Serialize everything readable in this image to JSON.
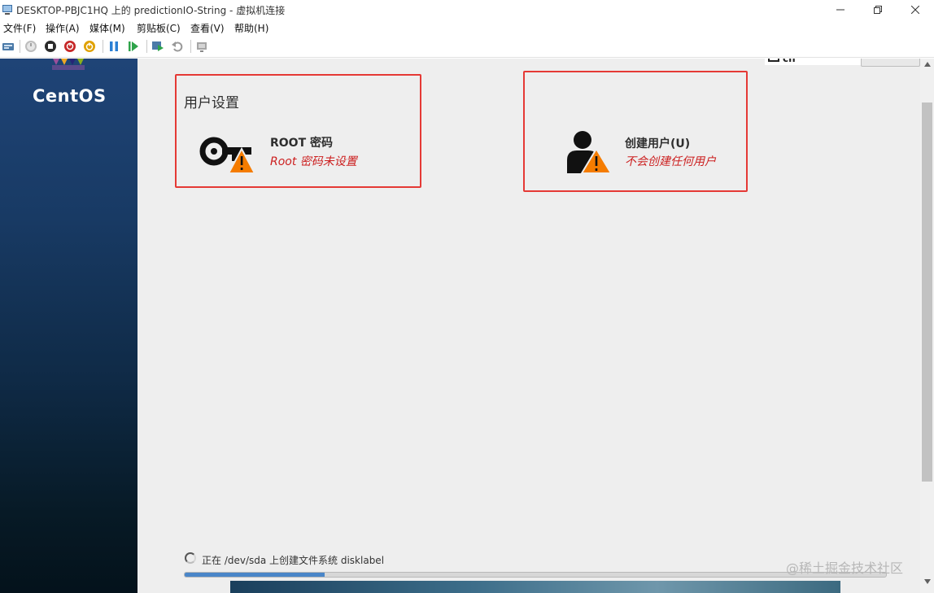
{
  "window": {
    "title": "DESKTOP-PBJC1HQ 上的 predictionIO-String - 虚拟机连接"
  },
  "menu": {
    "items": [
      "文件(F)",
      "操作(A)",
      "媒体(M)",
      "剪贴板(C)",
      "查看(V)",
      "帮助(H)"
    ]
  },
  "toolbar": {
    "icons": [
      "ctrl-alt-del-icon",
      "start-icon",
      "turn-off-icon",
      "shutdown-icon",
      "power-icon",
      "pause-icon",
      "resume-icon",
      "checkpoint-icon",
      "revert-icon",
      "enhanced-session-icon"
    ]
  },
  "installer": {
    "brand": "CentOS",
    "keyboard_indicator": "cn",
    "section_title": "用户设置",
    "root_spoke": {
      "label": "ROOT 密码",
      "status": "Root 密码未设置"
    },
    "user_spoke": {
      "label": "创建用户(U)",
      "status": "不会创建任何用户"
    },
    "progress": {
      "text": "正在 /dev/sda 上创建文件系统 disklabel",
      "fraction": 0.2
    }
  },
  "watermark": "@稀土掘金技术社区",
  "colors": {
    "highlight": "#e53935",
    "warning": "#f57c00",
    "status_text": "#cc1f1f",
    "progress": "#4a86c8",
    "sidebar": "#1f4477"
  }
}
